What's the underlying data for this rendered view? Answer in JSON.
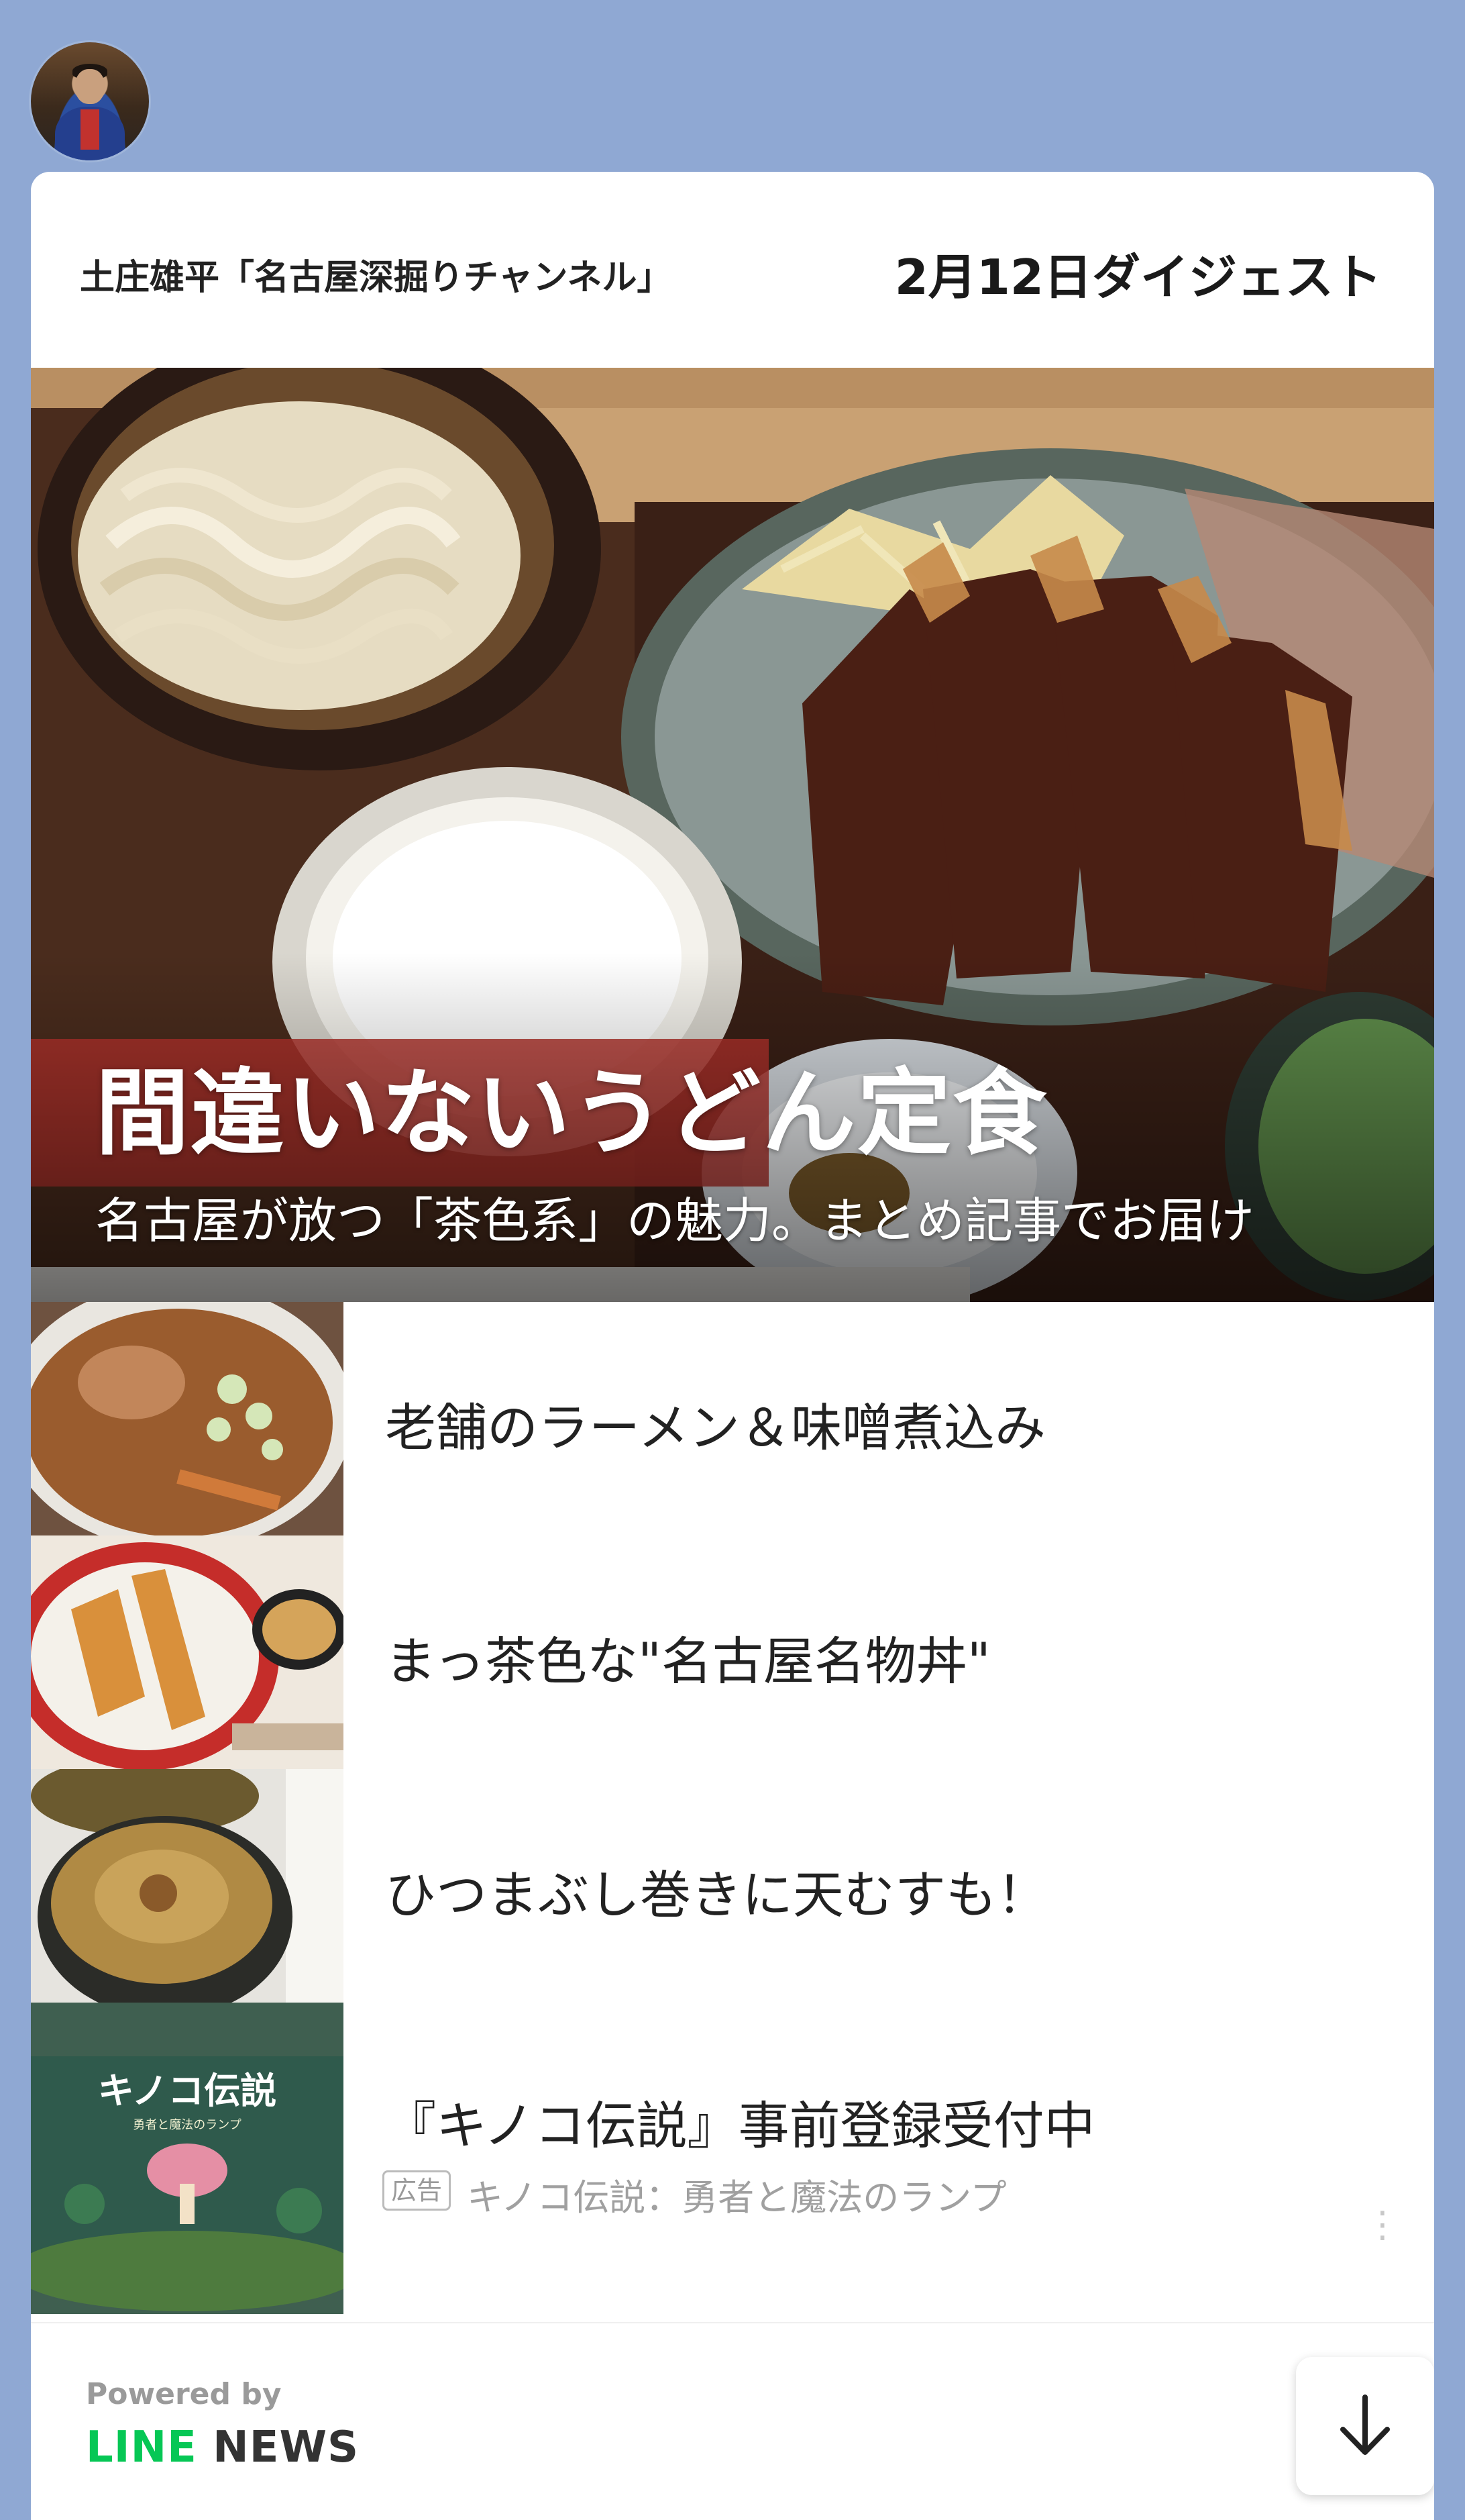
{
  "header": {
    "channel_name": "土庄雄平「名古屋深掘りチャンネル」",
    "digest_date": "2月12日ダイジェスト"
  },
  "hero": {
    "title": "間違いないうどん定食",
    "subtitle": "名古屋が放つ「茶色系」の魅力。まとめ記事でお届け"
  },
  "articles": [
    {
      "title": "老舗のラーメン＆味噌煮込み",
      "thumb_icon": "ramen-photo"
    },
    {
      "title": "まっ茶色な\"名古屋名物丼\"",
      "thumb_icon": "katsu-don-photo"
    },
    {
      "title": "ひつまぶし巻きに天むすも！",
      "thumb_icon": "rice-roll-photo"
    }
  ],
  "ad": {
    "title": "『キノコ伝説』事前登録受付中",
    "badge": "広告",
    "sponsor": "キノコ伝説：勇者と魔法のランプ",
    "thumb_text": "キノコ伝説",
    "thumb_subtext": "勇者と魔法のランプ"
  },
  "footer": {
    "powered_by": "Powered by",
    "brand_line": "LINE",
    "brand_news": "NEWS"
  },
  "colors": {
    "background": "#8fa8d3",
    "line_green": "#06c755"
  }
}
